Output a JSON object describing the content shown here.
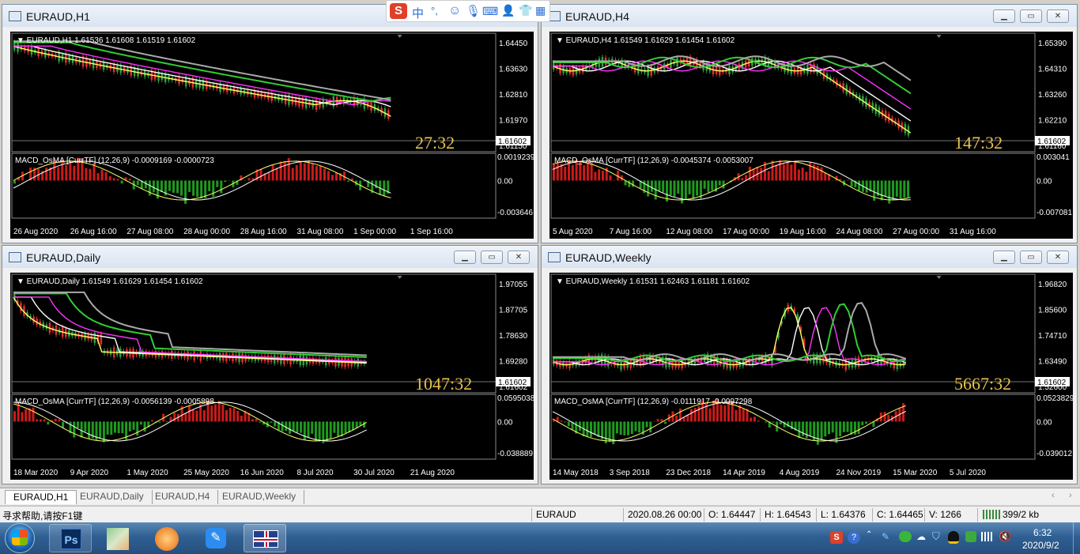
{
  "windows": [
    {
      "id": "h1",
      "title": "EURAUD,H1",
      "header": "EURAUD,H1  1.61536 1.61608 1.61519 1.61602",
      "price_labels": [
        "1.64450",
        "1.63630",
        "1.62810",
        "1.61970",
        "1.61150"
      ],
      "current_price": "1.61602",
      "timer": "27:32",
      "macd_header": "MACD_OsMA [CurrTF] (12,26,9) -0.0009169 -0.0000723",
      "macd_labels": [
        "0.0019239",
        "0.00",
        "-0.003646"
      ],
      "time_labels": [
        "26 Aug 2020",
        "26 Aug 16:00",
        "27 Aug 08:00",
        "28 Aug 00:00",
        "28 Aug 16:00",
        "31 Aug 08:00",
        "1 Sep 00:00",
        "1 Sep 16:00"
      ]
    },
    {
      "id": "h4",
      "title": "EURAUD,H4",
      "header": "EURAUD,H4  1.61549 1.61629 1.61454 1.61602",
      "price_labels": [
        "1.65390",
        "1.64310",
        "1.63260",
        "1.62210",
        "1.61160"
      ],
      "current_price": "1.61602",
      "timer": "147:32",
      "macd_header": "MACD_OsMA [CurrTF] (12,26,9) -0.0045374 -0.0053007",
      "macd_labels": [
        "0.003041",
        "0.00",
        "-0.007081"
      ],
      "time_labels": [
        "5 Aug 2020",
        "7 Aug 16:00",
        "12 Aug 08:00",
        "17 Aug 00:00",
        "19 Aug 16:00",
        "24 Aug 08:00",
        "27 Aug 00:00",
        "31 Aug 16:00"
      ]
    },
    {
      "id": "daily",
      "title": "EURAUD,Daily",
      "header": "EURAUD,Daily  1.61549 1.61629 1.61454 1.61602",
      "price_labels": [
        "1.97055",
        "1.87705",
        "1.78630",
        "1.69280",
        "1.61602"
      ],
      "current_price": "1.61602",
      "timer": "1047:32",
      "macd_header": "MACD_OsMA [CurrTF] (12,26,9) -0.0056139 -0.0005898",
      "macd_labels": [
        "0.0595038",
        "0.00",
        "-0.038889"
      ],
      "time_labels": [
        "18 Mar 2020",
        "9 Apr 2020",
        "1 May 2020",
        "25 May 2020",
        "16 Jun 2020",
        "8 Jul 2020",
        "30 Jul 2020",
        "21 Aug 2020"
      ]
    },
    {
      "id": "weekly",
      "title": "EURAUD,Weekly",
      "header": "EURAUD,Weekly  1.61531 1.62463 1.61181 1.61602",
      "price_labels": [
        "1.96820",
        "1.85600",
        "1.74710",
        "1.63490",
        "1.52600"
      ],
      "current_price": "1.61602",
      "timer": "5667:32",
      "macd_header": "MACD_OsMA [CurrTF] (12,26,9) -0.0111917 -0.0097298",
      "macd_labels": [
        "0.0523829",
        "0.00",
        "-0.039012"
      ],
      "time_labels": [
        "14 May 2018",
        "3 Sep 2018",
        "23 Dec 2018",
        "14 Apr 2019",
        "4 Aug 2019",
        "24 Nov 2019",
        "15 Mar 2020",
        "5 Jul 2020"
      ]
    }
  ],
  "tabs": [
    "EURAUD,H1",
    "EURAUD,Daily",
    "EURAUD,H4",
    "EURAUD,Weekly"
  ],
  "status": {
    "help": "寻求帮助,请按F1键",
    "symbol": "EURAUD",
    "datetime": "2020.08.26 00:00",
    "open": "O: 1.64447",
    "high": "H: 1.64543",
    "low": "L: 1.64376",
    "close": "C: 1.64465",
    "volume": "V: 1266",
    "traffic": "399/2 kb"
  },
  "ime": {
    "logo": "S",
    "lang": "中",
    "punct": "°,"
  },
  "taskbar": {
    "ps_label": "Ps",
    "time": "6:32",
    "date": "2020/9/2"
  }
}
